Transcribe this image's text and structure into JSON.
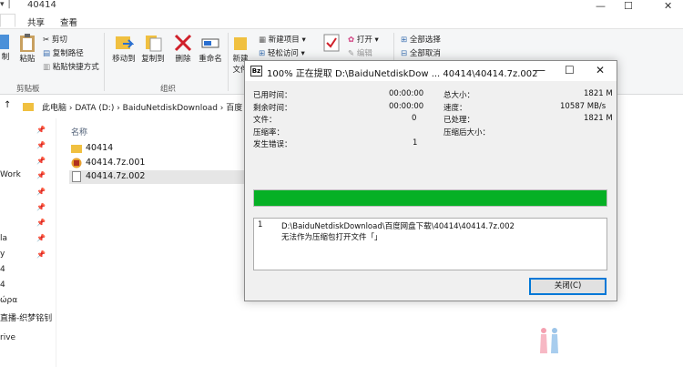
{
  "window": {
    "title": "40414",
    "qa_glyph": "▾ │"
  },
  "controls": {
    "min": "—",
    "max": "☐",
    "close": "✕"
  },
  "tabs": [
    "共享",
    "查看"
  ],
  "ribbon": {
    "cut": "剪切",
    "copy_path": "复制路径",
    "paste_shortcut": "粘贴快捷方式",
    "cut_left": "制",
    "paste": "粘贴",
    "clipboard_label": "剪贴板",
    "move_to": "移动到",
    "copy_to": "复制到",
    "delete": "删除",
    "rename": "重命名",
    "organize_label": "组织",
    "new_folder_a": "新建",
    "new_folder_b": "文件",
    "new_item": "新建项目",
    "easy_access": "轻松访问",
    "props": "属性",
    "open": "打开",
    "edit": "编辑",
    "select_all": "全部选择",
    "select_none": "全部取消"
  },
  "address": {
    "path": "此电脑  ›  DATA (D:)  ›  BaiduNetdiskDownload  ›  百度"
  },
  "nav": {
    "items": [
      "Work",
      "la",
      "y",
      "4",
      "4",
      "ώρα",
      "直播-织梦铭钊",
      "rive"
    ]
  },
  "files": {
    "header": "名称",
    "rows": [
      {
        "name": "40414",
        "icon": "folder-icon"
      },
      {
        "name": "40414.7z.001",
        "icon": "archive-icon"
      },
      {
        "name": "40414.7z.002",
        "icon": "file-icon"
      }
    ]
  },
  "dialog": {
    "logo": "Bz",
    "title": "100% 正在提取 D:\\BaiduNetdiskDow ... 40414\\40414.7z.002",
    "left": [
      {
        "label": "已用时间：",
        "value": "00:00:00"
      },
      {
        "label": "剩余时间：",
        "value": "00:00:00"
      },
      {
        "label": "文件：",
        "value": "0"
      },
      {
        "label": "压缩率：",
        "value": ""
      },
      {
        "label": "发生错误：",
        "value": "1"
      }
    ],
    "right": [
      {
        "label": "总大小：",
        "value": "1821 M"
      },
      {
        "label": "速度：",
        "value": "10587 MB/s"
      },
      {
        "label": "已处理：",
        "value": "1821 M"
      },
      {
        "label": "压缩后大小：",
        "value": ""
      }
    ],
    "progress": 1.0,
    "log": {
      "index": "1",
      "path": "D:\\BaiduNetdiskDownload\\百度网盘下载\\40414\\40414.7z.002",
      "message": "无法作为压缩包打开文件「」"
    },
    "close_label": "关闭(C)"
  },
  "colors": {
    "progress": "#06b025",
    "accent": "#0078d7"
  }
}
